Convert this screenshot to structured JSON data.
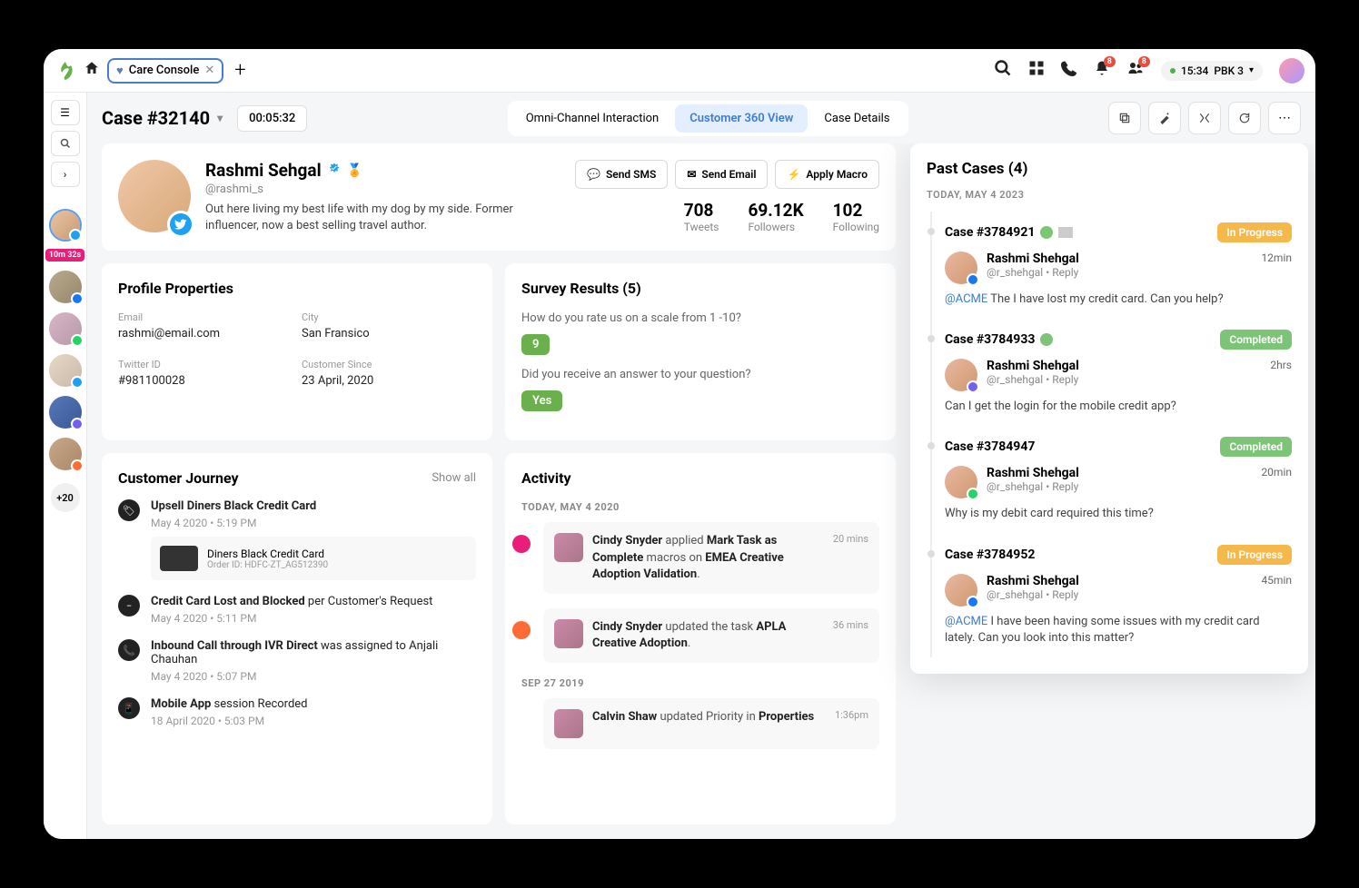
{
  "titlebar": {
    "tab_label": "Care Console",
    "time": "15:34",
    "workspace": "PBK 3",
    "notif_badge": "8",
    "team_badge": "8"
  },
  "left_rail": {
    "timer": "10m 32s",
    "more": "+20"
  },
  "subheader": {
    "case_title": "Case #32140",
    "timer": "00:05:32",
    "pills": [
      "Omni-Channel Interaction",
      "Customer 360 View",
      "Case Details"
    ]
  },
  "profile": {
    "name": "Rashmi Sehgal",
    "handle": "@rashmi_s",
    "bio": "Out here living my best life with my dog by my side. Former influencer, now a best selling travel author.",
    "btn_sms": "Send SMS",
    "btn_email": "Send Email",
    "btn_macro": "Apply Macro",
    "stats": [
      {
        "val": "708",
        "lbl": "Tweets"
      },
      {
        "val": "69.12K",
        "lbl": "Followers"
      },
      {
        "val": "102",
        "lbl": "Following"
      }
    ]
  },
  "properties": {
    "title": "Profile Properties",
    "items": [
      {
        "lbl": "Email",
        "val": "rashmi@email.com"
      },
      {
        "lbl": "City",
        "val": "San Fransico"
      },
      {
        "lbl": "Twitter ID",
        "val": "#981100028"
      },
      {
        "lbl": "Customer Since",
        "val": "23 April, 2020"
      }
    ]
  },
  "survey": {
    "title": "Survey Results (5)",
    "q1": "How do you rate us on a scale from 1 -10?",
    "a1": "9",
    "q2": "Did you receive an answer to your question?",
    "a2": "Yes"
  },
  "journey": {
    "title": "Customer Journey",
    "show_all": "Show all",
    "items": [
      {
        "title_strong": "Upsell Diners Black Credit Card",
        "title_rest": "",
        "meta": "May 4 2020 • 5:19 PM",
        "sub_title": "Diners Black Credit Card",
        "sub_id": "Order ID: HDFC-ZT_AG512390"
      },
      {
        "title_strong": "Credit Card Lost and Blocked",
        "title_rest": " per Customer's Request",
        "meta": "May 4 2020 • 5:11 PM"
      },
      {
        "title_strong": "Inbound Call through IVR Direct",
        "title_rest": " was assigned to Anjali Chauhan",
        "meta": "May 4 2020 • 5:07 PM"
      },
      {
        "title_strong": "Mobile App",
        "title_rest": " session Recorded",
        "meta": "18 April 2020 • 5:03 PM"
      }
    ]
  },
  "activity": {
    "title": "Activity",
    "date1": "TODAY, MAY 4 2020",
    "date2": "SEP 27 2019",
    "items1": [
      {
        "who": "Cindy Snyder",
        "mid": " applied ",
        "what": "Mark Task as Complete",
        "mid2": " macros on ",
        "what2": "EMEA Creative Adoption Validation",
        "tail": ".",
        "time": "20 mins"
      },
      {
        "who": "Cindy Snyder",
        "mid": " updated the task ",
        "what": "APLA Creative Adoption",
        "mid2": "",
        "what2": "",
        "tail": ".",
        "time": "36 mins"
      }
    ],
    "items2": [
      {
        "who": "Calvin Shaw",
        "mid": " updated Priority in ",
        "what": "Properties",
        "time": "1:36pm"
      }
    ]
  },
  "past": {
    "title": "Past Cases (4)",
    "date": "TODAY, MAY 4 2023",
    "cases": [
      {
        "id": "Case #3784921",
        "status": "In Progress",
        "status_type": "prog",
        "uname": "Rashmi Shehgal",
        "uhandle": "@r_shehgal",
        "reply": "Reply",
        "time": "12min",
        "msg_mention": "@ACME",
        "msg": " The I have lost my credit card. Can you help?",
        "icons": 2,
        "mini": "bl"
      },
      {
        "id": "Case #3784933",
        "status": "Completed",
        "status_type": "comp",
        "uname": "Rashmi Shehgal",
        "uhandle": "@r_shehgal",
        "reply": "Reply",
        "time": "2hrs",
        "msg_mention": "",
        "msg": "Can I get the login for the mobile credit app?",
        "icons": 1,
        "mini": "pu"
      },
      {
        "id": "Case #3784947",
        "status": "Completed",
        "status_type": "comp",
        "uname": "Rashmi Shehgal",
        "uhandle": "@r_shehgal",
        "reply": "Reply",
        "time": "20min",
        "msg_mention": "",
        "msg": "Why is my debit card required this time?",
        "icons": 0,
        "mini": "gr"
      },
      {
        "id": "Case #3784952",
        "status": "In Progress",
        "status_type": "prog",
        "uname": "Rashmi Shehgal",
        "uhandle": "@r_shehgal",
        "reply": "Reply",
        "time": "45min",
        "msg_mention": "@ACME",
        "msg": " I have been having some issues with my credit card lately. Can you look into this matter?",
        "icons": 0,
        "mini": "bl"
      }
    ]
  }
}
